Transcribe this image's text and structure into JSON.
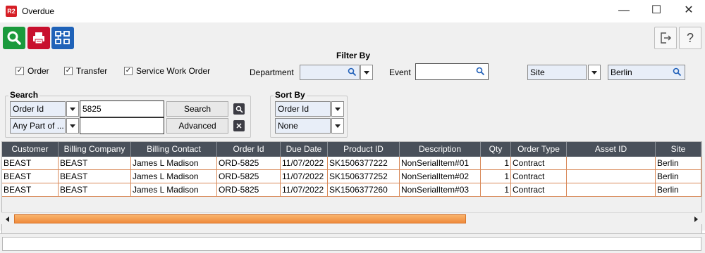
{
  "window": {
    "app_icon": "R2",
    "title": "Overdue",
    "minimize": "—",
    "maximize": "☐",
    "close": "✕"
  },
  "toolbar": {
    "left_buttons": [
      "search-icon",
      "print-icon",
      "layout-icon"
    ],
    "exit_icon": "exit-icon",
    "help_label": "?"
  },
  "filter": {
    "heading": "Filter By",
    "checkboxes": [
      {
        "label": "Order",
        "checked": true
      },
      {
        "label": "Transfer",
        "checked": true
      },
      {
        "label": "Service Work Order",
        "checked": true
      }
    ],
    "department_label": "Department",
    "department_value": "",
    "event_label": "Event",
    "event_value": "",
    "site_dropdown": "Site",
    "site_value": "Berlin"
  },
  "search": {
    "title": "Search",
    "field_select": "Order Id",
    "field_value": "5825",
    "match_select": "Any Part of ...",
    "match_value": "",
    "search_button": "Search",
    "advanced_button": "Advanced"
  },
  "sort": {
    "title": "Sort By",
    "primary": "Order Id",
    "secondary": "None"
  },
  "grid": {
    "columns": [
      "Customer",
      "Billing Company",
      "Billing Contact",
      "Order Id",
      "Due Date",
      "Product ID",
      "Description",
      "Qty",
      "Order Type",
      "Asset ID",
      "Site"
    ],
    "rows": [
      [
        "BEAST",
        "BEAST",
        "James L Madison",
        "ORD-5825",
        "11/07/2022",
        "SK1506377222",
        "NonSerialItem#01",
        "1",
        "Contract",
        "",
        "Berlin"
      ],
      [
        "BEAST",
        "BEAST",
        "James L Madison",
        "ORD-5825",
        "11/07/2022",
        "SK1506377252",
        "NonSerialItem#02",
        "1",
        "Contract",
        "",
        "Berlin"
      ],
      [
        "BEAST",
        "BEAST",
        "James L Madison",
        "ORD-5825",
        "11/07/2022",
        "SK1506377260",
        "NonSerialItem#03",
        "1",
        "Contract",
        "",
        "Berlin"
      ]
    ]
  },
  "colors": {
    "header_bg": "#49505a",
    "row_border": "#d98a5a",
    "scroll_thumb": "#ef8a3c",
    "accent_green": "#1a9a3c",
    "accent_red": "#c8102e",
    "accent_blue": "#1f62b8"
  }
}
